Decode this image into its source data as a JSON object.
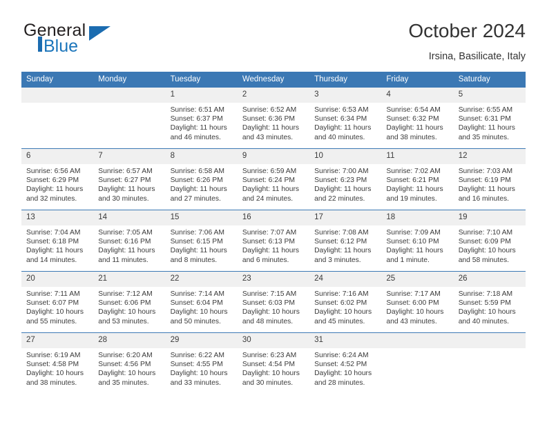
{
  "brand": {
    "name_part1": "General",
    "name_part2": "Blue"
  },
  "header": {
    "title": "October 2024",
    "subtitle": "Irsina, Basilicate, Italy"
  },
  "colors": {
    "header_blue": "#3b78b4",
    "brand_blue": "#1b75bb",
    "daynum_band": "#f0f0f0",
    "text": "#3a3a3a"
  },
  "weekdays": [
    "Sunday",
    "Monday",
    "Tuesday",
    "Wednesday",
    "Thursday",
    "Friday",
    "Saturday"
  ],
  "weeks": [
    [
      {
        "day": "",
        "empty": true
      },
      {
        "day": "",
        "empty": true
      },
      {
        "day": "1",
        "sunrise": "Sunrise: 6:51 AM",
        "sunset": "Sunset: 6:37 PM",
        "daylight1": "Daylight: 11 hours",
        "daylight2": "and 46 minutes."
      },
      {
        "day": "2",
        "sunrise": "Sunrise: 6:52 AM",
        "sunset": "Sunset: 6:36 PM",
        "daylight1": "Daylight: 11 hours",
        "daylight2": "and 43 minutes."
      },
      {
        "day": "3",
        "sunrise": "Sunrise: 6:53 AM",
        "sunset": "Sunset: 6:34 PM",
        "daylight1": "Daylight: 11 hours",
        "daylight2": "and 40 minutes."
      },
      {
        "day": "4",
        "sunrise": "Sunrise: 6:54 AM",
        "sunset": "Sunset: 6:32 PM",
        "daylight1": "Daylight: 11 hours",
        "daylight2": "and 38 minutes."
      },
      {
        "day": "5",
        "sunrise": "Sunrise: 6:55 AM",
        "sunset": "Sunset: 6:31 PM",
        "daylight1": "Daylight: 11 hours",
        "daylight2": "and 35 minutes."
      }
    ],
    [
      {
        "day": "6",
        "sunrise": "Sunrise: 6:56 AM",
        "sunset": "Sunset: 6:29 PM",
        "daylight1": "Daylight: 11 hours",
        "daylight2": "and 32 minutes."
      },
      {
        "day": "7",
        "sunrise": "Sunrise: 6:57 AM",
        "sunset": "Sunset: 6:27 PM",
        "daylight1": "Daylight: 11 hours",
        "daylight2": "and 30 minutes."
      },
      {
        "day": "8",
        "sunrise": "Sunrise: 6:58 AM",
        "sunset": "Sunset: 6:26 PM",
        "daylight1": "Daylight: 11 hours",
        "daylight2": "and 27 minutes."
      },
      {
        "day": "9",
        "sunrise": "Sunrise: 6:59 AM",
        "sunset": "Sunset: 6:24 PM",
        "daylight1": "Daylight: 11 hours",
        "daylight2": "and 24 minutes."
      },
      {
        "day": "10",
        "sunrise": "Sunrise: 7:00 AM",
        "sunset": "Sunset: 6:23 PM",
        "daylight1": "Daylight: 11 hours",
        "daylight2": "and 22 minutes."
      },
      {
        "day": "11",
        "sunrise": "Sunrise: 7:02 AM",
        "sunset": "Sunset: 6:21 PM",
        "daylight1": "Daylight: 11 hours",
        "daylight2": "and 19 minutes."
      },
      {
        "day": "12",
        "sunrise": "Sunrise: 7:03 AM",
        "sunset": "Sunset: 6:19 PM",
        "daylight1": "Daylight: 11 hours",
        "daylight2": "and 16 minutes."
      }
    ],
    [
      {
        "day": "13",
        "sunrise": "Sunrise: 7:04 AM",
        "sunset": "Sunset: 6:18 PM",
        "daylight1": "Daylight: 11 hours",
        "daylight2": "and 14 minutes."
      },
      {
        "day": "14",
        "sunrise": "Sunrise: 7:05 AM",
        "sunset": "Sunset: 6:16 PM",
        "daylight1": "Daylight: 11 hours",
        "daylight2": "and 11 minutes."
      },
      {
        "day": "15",
        "sunrise": "Sunrise: 7:06 AM",
        "sunset": "Sunset: 6:15 PM",
        "daylight1": "Daylight: 11 hours",
        "daylight2": "and 8 minutes."
      },
      {
        "day": "16",
        "sunrise": "Sunrise: 7:07 AM",
        "sunset": "Sunset: 6:13 PM",
        "daylight1": "Daylight: 11 hours",
        "daylight2": "and 6 minutes."
      },
      {
        "day": "17",
        "sunrise": "Sunrise: 7:08 AM",
        "sunset": "Sunset: 6:12 PM",
        "daylight1": "Daylight: 11 hours",
        "daylight2": "and 3 minutes."
      },
      {
        "day": "18",
        "sunrise": "Sunrise: 7:09 AM",
        "sunset": "Sunset: 6:10 PM",
        "daylight1": "Daylight: 11 hours",
        "daylight2": "and 1 minute."
      },
      {
        "day": "19",
        "sunrise": "Sunrise: 7:10 AM",
        "sunset": "Sunset: 6:09 PM",
        "daylight1": "Daylight: 10 hours",
        "daylight2": "and 58 minutes."
      }
    ],
    [
      {
        "day": "20",
        "sunrise": "Sunrise: 7:11 AM",
        "sunset": "Sunset: 6:07 PM",
        "daylight1": "Daylight: 10 hours",
        "daylight2": "and 55 minutes."
      },
      {
        "day": "21",
        "sunrise": "Sunrise: 7:12 AM",
        "sunset": "Sunset: 6:06 PM",
        "daylight1": "Daylight: 10 hours",
        "daylight2": "and 53 minutes."
      },
      {
        "day": "22",
        "sunrise": "Sunrise: 7:14 AM",
        "sunset": "Sunset: 6:04 PM",
        "daylight1": "Daylight: 10 hours",
        "daylight2": "and 50 minutes."
      },
      {
        "day": "23",
        "sunrise": "Sunrise: 7:15 AM",
        "sunset": "Sunset: 6:03 PM",
        "daylight1": "Daylight: 10 hours",
        "daylight2": "and 48 minutes."
      },
      {
        "day": "24",
        "sunrise": "Sunrise: 7:16 AM",
        "sunset": "Sunset: 6:02 PM",
        "daylight1": "Daylight: 10 hours",
        "daylight2": "and 45 minutes."
      },
      {
        "day": "25",
        "sunrise": "Sunrise: 7:17 AM",
        "sunset": "Sunset: 6:00 PM",
        "daylight1": "Daylight: 10 hours",
        "daylight2": "and 43 minutes."
      },
      {
        "day": "26",
        "sunrise": "Sunrise: 7:18 AM",
        "sunset": "Sunset: 5:59 PM",
        "daylight1": "Daylight: 10 hours",
        "daylight2": "and 40 minutes."
      }
    ],
    [
      {
        "day": "27",
        "sunrise": "Sunrise: 6:19 AM",
        "sunset": "Sunset: 4:58 PM",
        "daylight1": "Daylight: 10 hours",
        "daylight2": "and 38 minutes."
      },
      {
        "day": "28",
        "sunrise": "Sunrise: 6:20 AM",
        "sunset": "Sunset: 4:56 PM",
        "daylight1": "Daylight: 10 hours",
        "daylight2": "and 35 minutes."
      },
      {
        "day": "29",
        "sunrise": "Sunrise: 6:22 AM",
        "sunset": "Sunset: 4:55 PM",
        "daylight1": "Daylight: 10 hours",
        "daylight2": "and 33 minutes."
      },
      {
        "day": "30",
        "sunrise": "Sunrise: 6:23 AM",
        "sunset": "Sunset: 4:54 PM",
        "daylight1": "Daylight: 10 hours",
        "daylight2": "and 30 minutes."
      },
      {
        "day": "31",
        "sunrise": "Sunrise: 6:24 AM",
        "sunset": "Sunset: 4:52 PM",
        "daylight1": "Daylight: 10 hours",
        "daylight2": "and 28 minutes."
      },
      {
        "day": "",
        "empty": true
      },
      {
        "day": "",
        "empty": true
      }
    ]
  ]
}
